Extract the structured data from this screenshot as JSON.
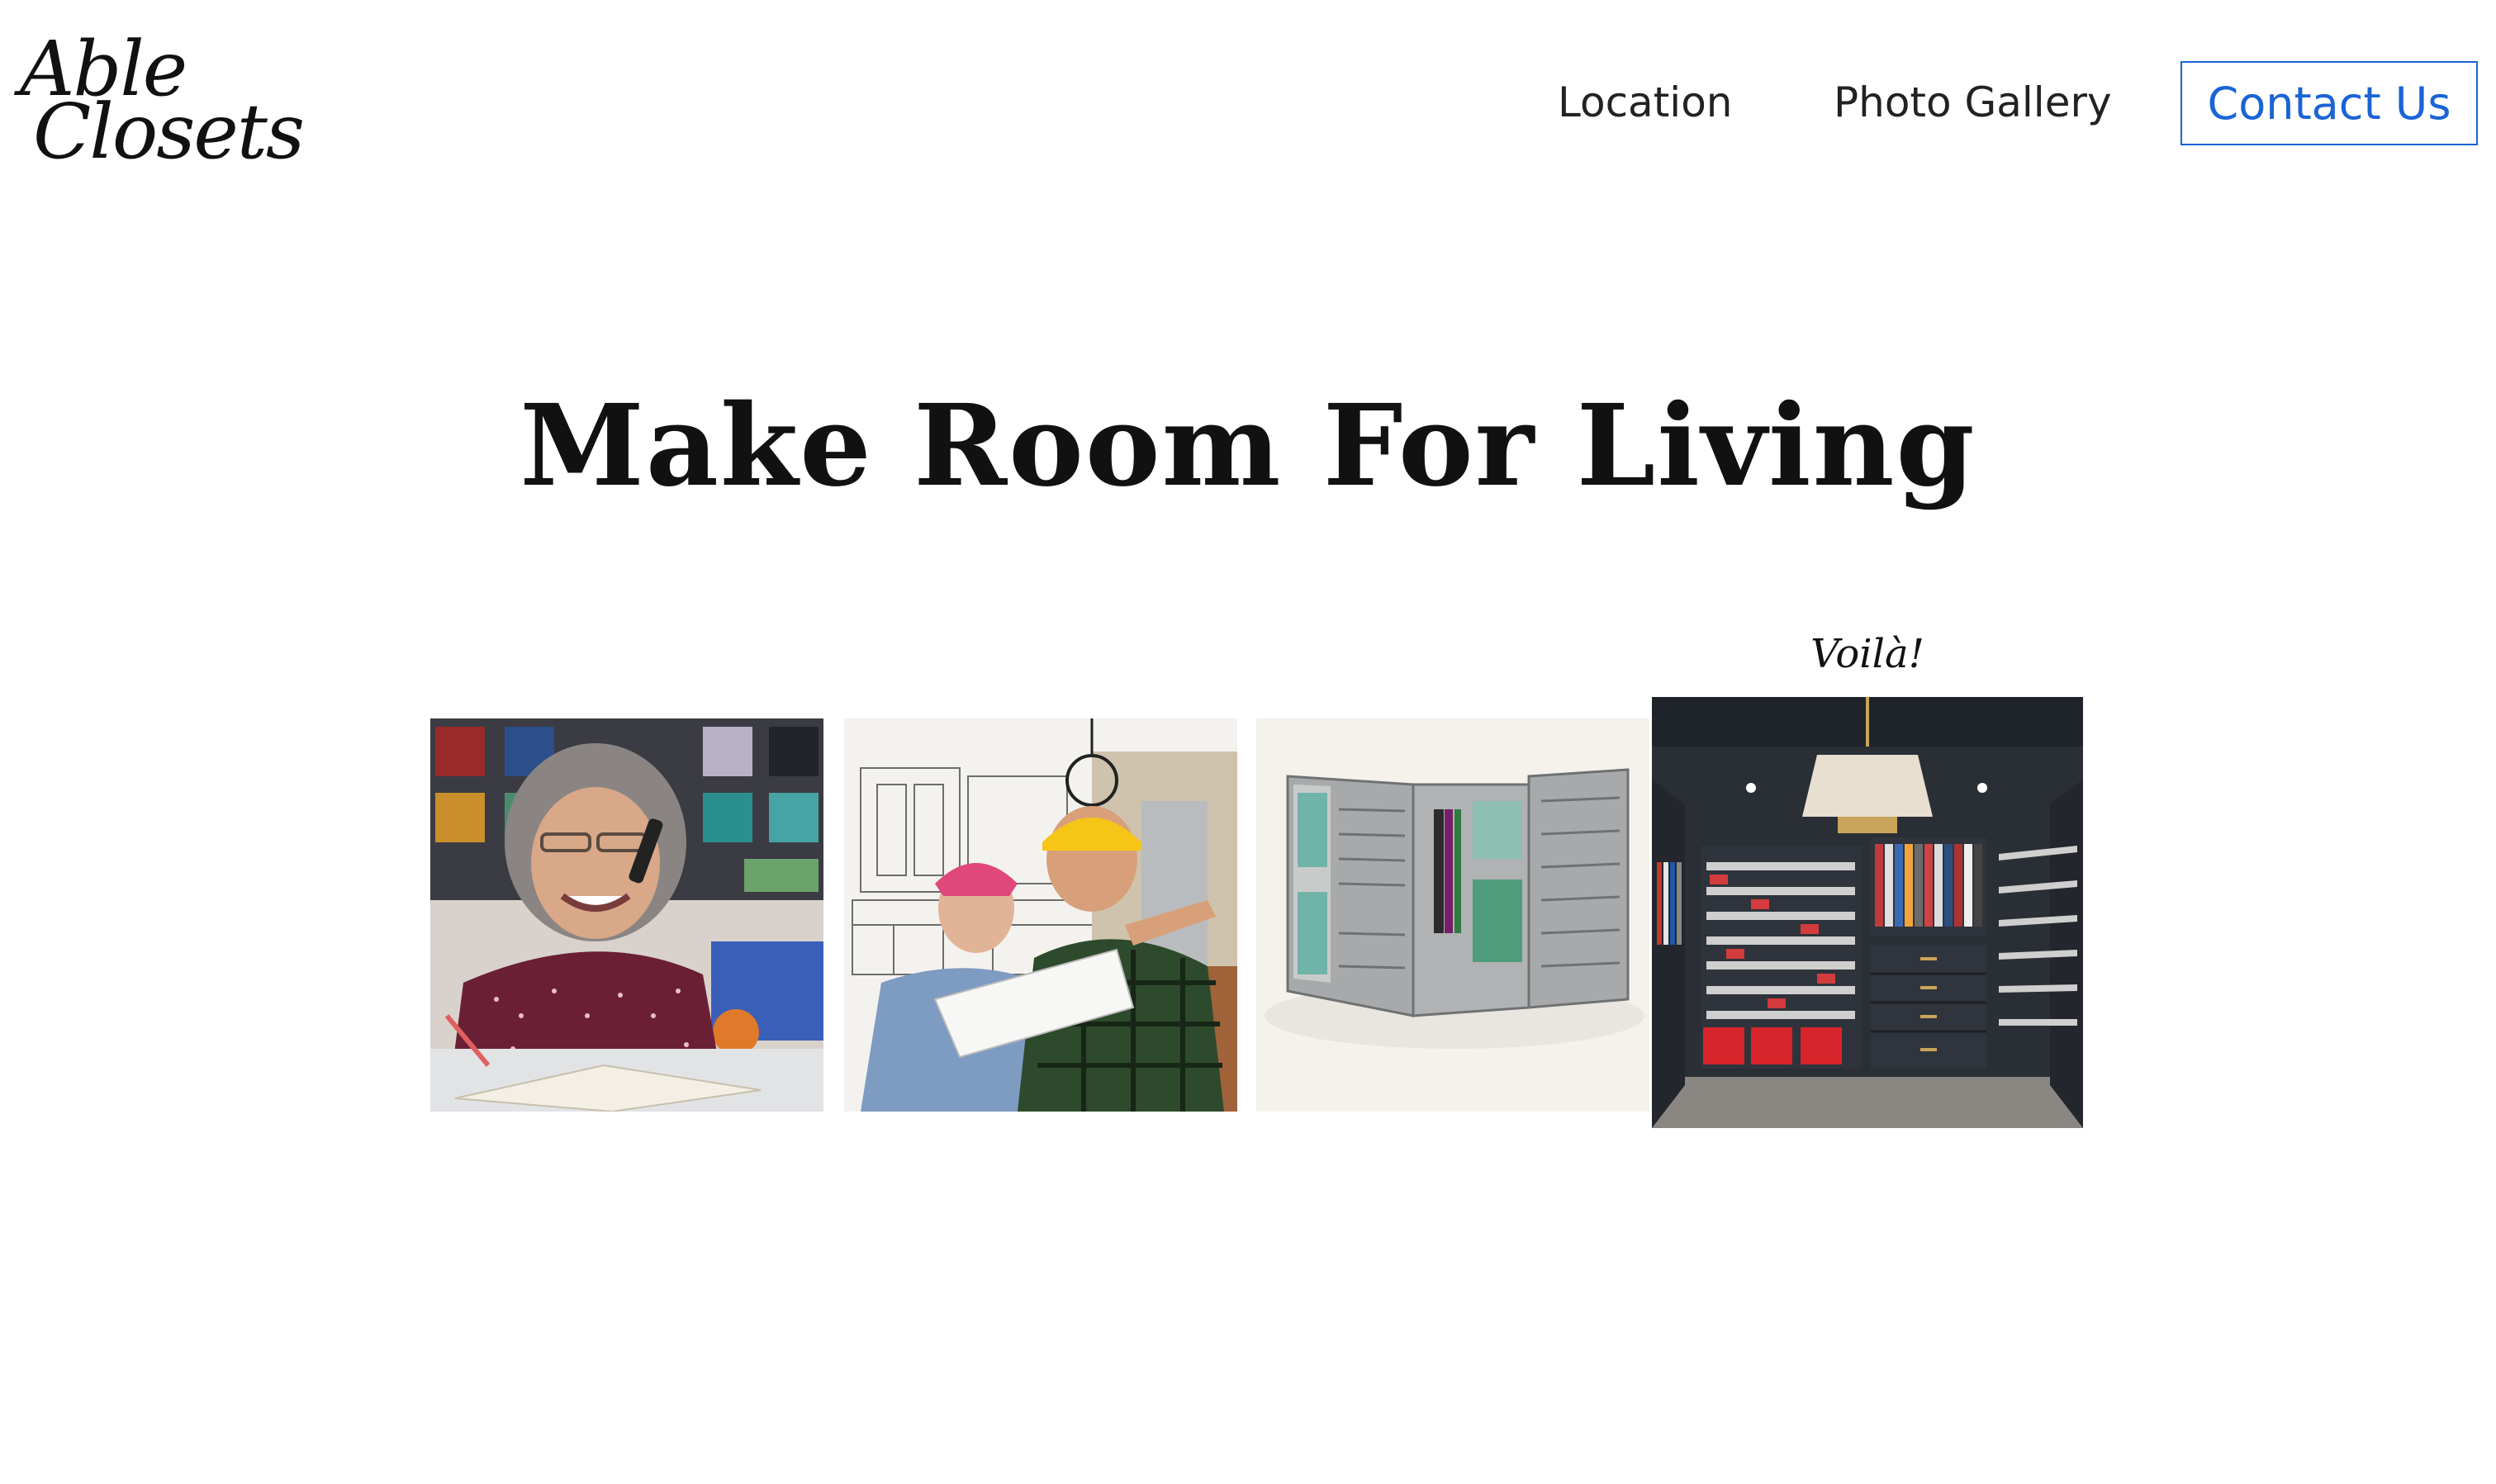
{
  "header": {
    "logo": {
      "line1": "Able",
      "line2": "Closets"
    },
    "nav": [
      {
        "label": "Location"
      },
      {
        "label": "Photo Gallery"
      }
    ],
    "contact_label": "Contact Us",
    "accent_color": "#1a64d6"
  },
  "hero": {
    "headline": "Make Room For Living"
  },
  "gallery": {
    "caption": "Voilà!",
    "tiles": [
      {
        "icon": "woman-on-phone-photo"
      },
      {
        "icon": "contractor-blueprint-photo"
      },
      {
        "icon": "closet-design-render"
      },
      {
        "icon": "finished-walk-in-closet-photo"
      }
    ]
  }
}
